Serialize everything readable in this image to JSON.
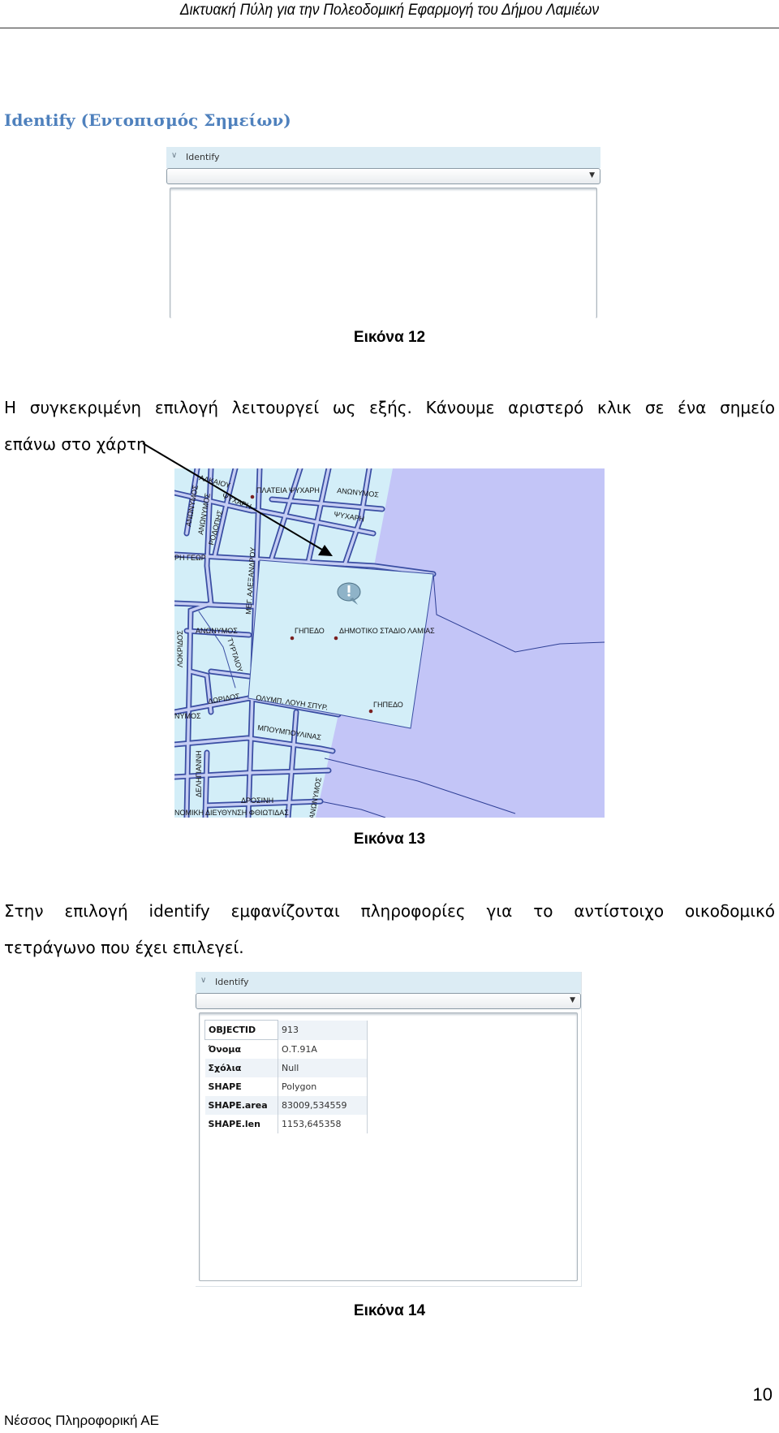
{
  "header": {
    "title": "Δικτυακή Πύλη για την Πολεοδομική Εφαρμογή του Δήμου Λαμιέων"
  },
  "section_title": "Identify (Εντοπισμός Σημείων)",
  "figure12": {
    "panel_title": "Identify",
    "caption": "Εικόνα 12"
  },
  "paragraph1": {
    "line1": "Η συγκεκριμένη επιλογή λειτουργεί ως εξής. Κάνουμε αριστερό κλικ σε ένα σημείο",
    "line2": "επάνω στο χάρτη"
  },
  "figure13": {
    "caption": "Εικόνα 13",
    "colors": {
      "land": "#d3eef8",
      "sea": "#c3c5f7",
      "road_edge": "#3a4ea3",
      "road_fill": "#c5cdf3"
    },
    "labels": {
      "plateia": "ΠΛΑΤΕΙΑ ΨΥΧΑΡΗ",
      "anonymos_top": "ΑΝΩΝΥΜΟΣ",
      "psyxari_right": "ΨΥΧΑΡΗ",
      "psyxari_left": "ΨΥΧΑΡΗ",
      "anonymos_v1": "ΑΝΩΝΥΜΟΣ",
      "anonymos_v2": "ΑΝΩΝΥΜΟΣ",
      "rodopis": "ΡΟΔΟΠΗΣ",
      "alkaiou": "ΑΛΚΑΙΟΥ",
      "georgiou": "ΡΗ ΓΕΩΡ",
      "alexandrou": "ΜΕΓ. ΑΛΕΞΑΝΔΡΟΥ",
      "anonymos_mid": "ΑΝΩΝΥΜΟΣ",
      "gipedo1": "ΓΗΠΕΔΟ",
      "stadio": "ΔΗΜΟΤΙΚΟ ΣΤΑΔΙΟ ΛΑΜΙΑΣ",
      "tyrtaiou": "ΤΥΡΤΑΙΟΥ",
      "lokridos": "ΛΟΚΡΙΔΟΣ",
      "doridos": "ΔΩΡΙΔΟΣ",
      "louis": "ΟΛΥΜΠ. ΛΟΥΗ ΣΠΥΡ.",
      "gipedo2": "ΓΗΠΕΔΟ",
      "anonymos_left": "ΝΥΜΟΣ",
      "boumboulinas": "ΜΠΟΥΜΠΟΥΛΙΝΑΣ",
      "deligianni": "ΔΕΛΗΓΙΑΝΝΗ",
      "drosini": "ΔΡΟΣΙΝΗ",
      "nomiki": "ΝΟΜΙΚΗ ΔΙΕΥΘΥΝΣΗ ΦΘΙΩΤΙΔΑΣ",
      "anonymos_bottom": "ΑΝΩΝΥΜΟΣ"
    },
    "icons": [
      "info-balloon-icon",
      "arrow-pointer"
    ]
  },
  "paragraph2": {
    "line1": "Στην επιλογή identify εμφανίζονται πληροφορίες για το αντίστοιχο οικοδομικό",
    "line2": "τετράγωνο που έχει επιλεγεί."
  },
  "figure14": {
    "panel_title": "Identify",
    "caption": "Εικόνα 14",
    "rows": [
      {
        "key": "OBJECTID",
        "value": "913"
      },
      {
        "key": "Όνομα",
        "value": "Ο.Τ.91Α"
      },
      {
        "key": "Σχόλια",
        "value": "Null"
      },
      {
        "key": "SHAPE",
        "value": "Polygon"
      },
      {
        "key": "SHAPE.area",
        "value": "83009,534559"
      },
      {
        "key": "SHAPE.len",
        "value": "1153,645358"
      }
    ]
  },
  "footer": {
    "company": "Νέσσος Πληροφορική ΑΕ",
    "page_number": "10"
  }
}
